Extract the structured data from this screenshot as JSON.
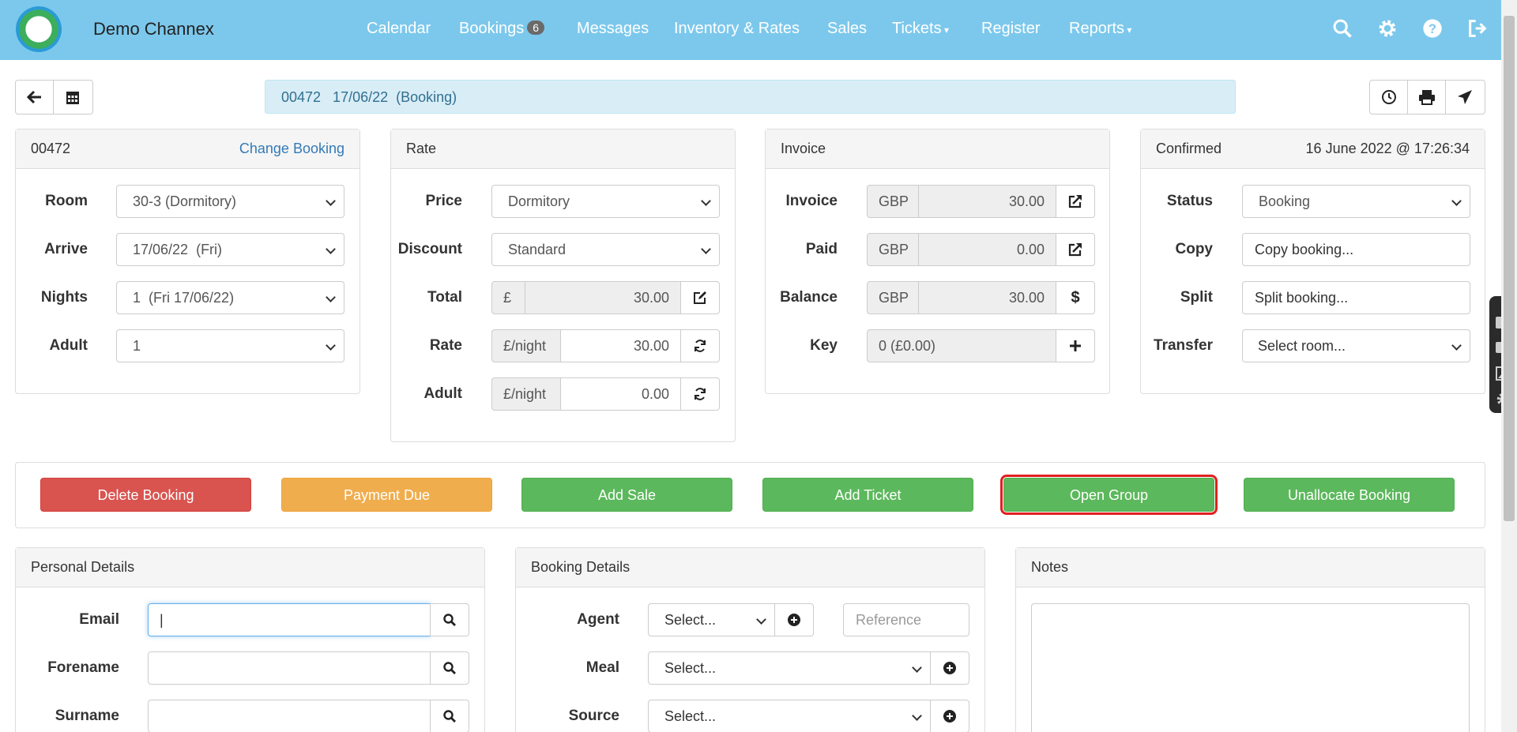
{
  "nav": {
    "brand": "Demo Channex",
    "items": [
      {
        "label": "Calendar"
      },
      {
        "label": "Bookings",
        "badge": "6"
      },
      {
        "label": "Messages"
      },
      {
        "label": "Inventory & Rates"
      },
      {
        "label": "Sales"
      },
      {
        "label": "Tickets"
      },
      {
        "label": "Register"
      },
      {
        "label": "Reports"
      }
    ],
    "icons": [
      "search-icon",
      "gear-icon",
      "help-icon",
      "logout-icon"
    ]
  },
  "titlebar": {
    "text": "00472   17/06/22  (Booking)"
  },
  "booking_panel": {
    "id": "00472",
    "change_link": "Change Booking",
    "fields": [
      {
        "label": "Room",
        "value": "30-3 (Dormitory)"
      },
      {
        "label": "Arrive",
        "value": "17/06/22  (Fri)"
      },
      {
        "label": "Nights",
        "value": "1  (Fri 17/06/22)"
      },
      {
        "label": "Adult",
        "value": "1"
      }
    ]
  },
  "rate_panel": {
    "title": "Rate",
    "price_label": "Price",
    "price_value": "Dormitory",
    "discount_label": "Discount",
    "discount_value": "Standard",
    "total_label": "Total",
    "total_currency": "£",
    "total_value": "30.00",
    "rate_label": "Rate",
    "rate_unit": "£/night",
    "rate_value": "30.00",
    "adult_label": "Adult",
    "adult_unit": "£/night",
    "adult_value": "0.00"
  },
  "invoice_panel": {
    "title": "Invoice",
    "invoice_label": "Invoice",
    "invoice_cur": "GBP",
    "invoice_value": "30.00",
    "paid_label": "Paid",
    "paid_cur": "GBP",
    "paid_value": "0.00",
    "balance_label": "Balance",
    "balance_cur": "GBP",
    "balance_value": "30.00",
    "key_label": "Key",
    "key_value": "0 (£0.00)"
  },
  "status_panel": {
    "title": "Confirmed",
    "timestamp": "16 June 2022 @ 17:26:34",
    "status_label": "Status",
    "status_value": "Booking",
    "copy_label": "Copy",
    "copy_value": "Copy booking...",
    "split_label": "Split",
    "split_value": "Split booking...",
    "transfer_label": "Transfer",
    "transfer_value": "Select room..."
  },
  "actions": {
    "delete": "Delete Booking",
    "payment": "Payment Due",
    "add_sale": "Add Sale",
    "add_ticket": "Add Ticket",
    "open_group": "Open Group",
    "unallocate": "Unallocate Booking"
  },
  "personal": {
    "title": "Personal Details",
    "email_label": "Email",
    "forename_label": "Forename",
    "surname_label": "Surname"
  },
  "booking_details": {
    "title": "Booking Details",
    "agent_label": "Agent",
    "agent_value": "Select...",
    "reference_placeholder": "Reference",
    "meal_label": "Meal",
    "meal_value": "Select...",
    "source_label": "Source",
    "source_value": "Select..."
  },
  "notes": {
    "title": "Notes"
  }
}
